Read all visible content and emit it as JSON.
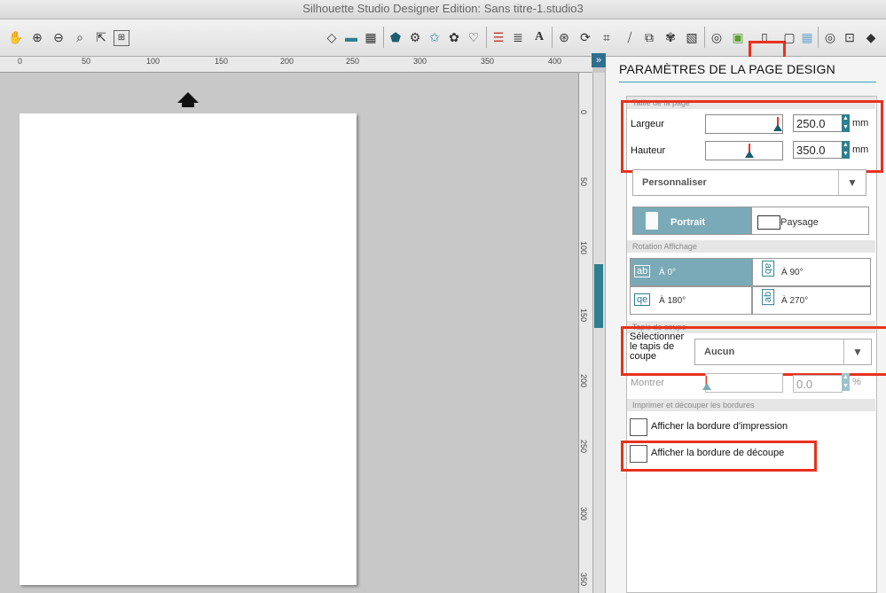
{
  "window": {
    "title": "Silhouette Studio Designer Edition: Sans titre-1.studio3"
  },
  "toolbar": {
    "icons": [
      "pan-icon",
      "zoom-in-icon",
      "zoom-out-icon",
      "zoom-select-icon",
      "drag-zoom-icon",
      "fit-page-icon",
      "fill-icon",
      "line-color-icon",
      "fill-pattern-icon",
      "shape-pentagon-icon",
      "shape-gear-icon",
      "shape-star-icon",
      "shape-flower-icon",
      "shape-heart-icon",
      "align-icon",
      "replicate-icon",
      "text-icon",
      "offset-icon",
      "trace-icon",
      "page-setup-icon",
      "cut-settings-icon",
      "grid-icon",
      "send-icon",
      "eraser-icon"
    ]
  },
  "ruler": {
    "h_labels": [
      "0",
      "50",
      "100",
      "150",
      "200",
      "250",
      "300",
      "350",
      "400"
    ],
    "v_labels": [
      "0",
      "50",
      "100",
      "150",
      "200",
      "250",
      "300",
      "350"
    ]
  },
  "panel": {
    "title": "PARAMÈTRES DE LA PAGE DESIGN",
    "page_size_section": "Taille de la page",
    "width_label": "Largeur",
    "width_value": "250.0",
    "height_label": "Hauteur",
    "height_value": "350.0",
    "unit": "mm",
    "preset_value": "Personnaliser",
    "portrait_label": "Portrait",
    "landscape_label": "Paysage",
    "rotation_section": "Rotation Affichage",
    "rot_0": "À 0°",
    "rot_90": "À 90°",
    "rot_180": "À 180°",
    "rot_270": "À 270°",
    "cutting_mat_section": "Tapis de coupe",
    "select_mat_label": "Sélectionner le tapis de coupe",
    "mat_value": "Aucun",
    "show_label": "Montrer",
    "show_value": "0.0",
    "show_unit": "%",
    "borders_section": "Imprimer et découper les bordures",
    "print_border_label": "Afficher la bordure d'impression",
    "cut_border_label": "Afficher la bordure de découpe"
  },
  "colors": {
    "accent": "#2e7f8f",
    "highlight": "#e8321e",
    "selected": "#7aa9b7"
  }
}
